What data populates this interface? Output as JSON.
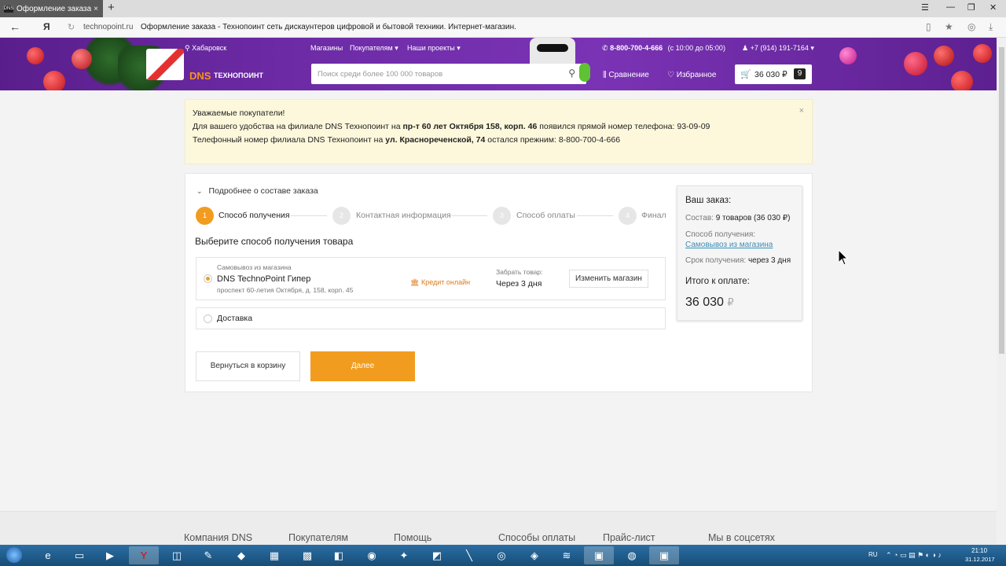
{
  "browser": {
    "tab_title": "Оформление заказа - Те",
    "tab_favicon": "DNS",
    "address": "technopoint.ru",
    "page_title": "Оформление заказа - Технопоинт сеть дискаунтеров цифровой и бытовой техники. Интернет-магазин.",
    "yandex_label": "Я"
  },
  "header": {
    "city": "Хабаровск",
    "logo_dns": "DNS",
    "logo_brand": "ТЕХНОПОИНТ",
    "nav": [
      "Магазины",
      "Покупателям",
      "Наши проекты"
    ],
    "phone": "8-800-700-4-666",
    "phone_hours": "(с 10:00 до 05:00)",
    "account_phone": "+7 (914) 191-7164",
    "search_placeholder": "Поиск среди более 100 000 товаров",
    "compare_label": "Сравнение",
    "favorites_label": "Избранное",
    "cart_sum": "36 030 ₽",
    "cart_count": "9"
  },
  "notice": {
    "line1": "Уважаемые покупатели!",
    "line2_prefix": "Для вашего удобства на филиале DNS Технопоинт на ",
    "line2_bold": "пр-т 60 лет Октября 158, корп. 46",
    "line2_suffix": " появился прямой номер телефона: 93-09-09",
    "line3_prefix": "Телефонный номер филиала DNS Технопоинт на ",
    "line3_bold": "ул. Краснореченской, 74",
    "line3_suffix": " остался прежним: 8-800-700-4-666",
    "close": "×"
  },
  "checkout": {
    "details_toggle": "Подробнее о составе заказа",
    "steps": [
      {
        "num": "1",
        "label": "Способ получения"
      },
      {
        "num": "2",
        "label": "Контактная информация"
      },
      {
        "num": "3",
        "label": "Способ оплаты"
      },
      {
        "num": "4",
        "label": "Финал"
      }
    ],
    "section_title": "Выберите способ получения товара",
    "pickup": {
      "caption": "Самовывоз из магазина",
      "store": "DNS TechnoPoint Гипер",
      "address": "проспект 60-летия Октября, д. 158, корп. 45",
      "credit": "Кредит онлайн",
      "pickup_caption": "Забрать товар:",
      "pickup_when": "Через 3 дня",
      "change_store": "Изменить магазин"
    },
    "delivery_label": "Доставка",
    "back_button": "Вернуться в корзину",
    "next_button": "Далее"
  },
  "summary": {
    "title": "Ваш заказ:",
    "composition_label": "Состав:",
    "composition_value": "9 товаров (36 030 ₽)",
    "method_label": "Способ получения:",
    "method_value": "Самовывоз из магазина",
    "time_label": "Срок получения:",
    "time_value": "через 3 дня",
    "total_label": "Итого к оплате:",
    "total_value": "36 030",
    "currency": "₽"
  },
  "footer": [
    "Компания DNS",
    "Покупателям",
    "Помощь",
    "Способы оплаты",
    "Прайс-лист",
    "Мы в соцсетях"
  ],
  "taskbar": {
    "lang": "RU",
    "time": "21:10",
    "date": "31.12.2017"
  },
  "colors": {
    "accent": "#f29c1f",
    "header_purple": "#6d2ba6",
    "notice_bg": "#fdf8dc",
    "link": "#3a8fb7"
  }
}
